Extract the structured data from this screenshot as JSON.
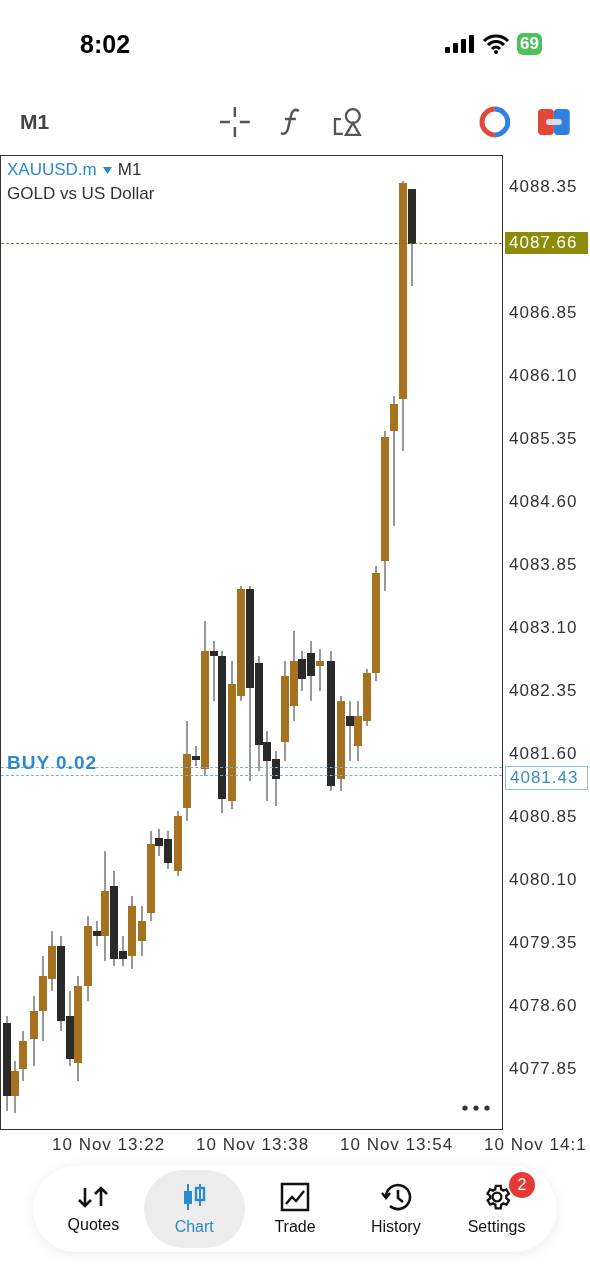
{
  "status_bar": {
    "time": "8:02",
    "battery": "69"
  },
  "toolbar": {
    "timeframe": "M1"
  },
  "chart": {
    "symbol": "XAUUSD.m",
    "timeframe": "M1",
    "description": "GOLD vs US Dollar",
    "price_axis": [
      {
        "text": "4088.35",
        "kind": "tick"
      },
      {
        "text": "4087.66",
        "kind": "current"
      },
      {
        "text": "4086.85",
        "kind": "tick"
      },
      {
        "text": "4086.10",
        "kind": "tick"
      },
      {
        "text": "4085.35",
        "kind": "tick"
      },
      {
        "text": "4084.60",
        "kind": "tick"
      },
      {
        "text": "4083.85",
        "kind": "tick"
      },
      {
        "text": "4083.10",
        "kind": "tick"
      },
      {
        "text": "4082.35",
        "kind": "tick"
      },
      {
        "text": "4081.60",
        "kind": "tick"
      },
      {
        "text": "4081.43",
        "kind": "order"
      },
      {
        "text": "4080.85",
        "kind": "tick"
      },
      {
        "text": "4080.10",
        "kind": "tick"
      },
      {
        "text": "4079.35",
        "kind": "tick"
      },
      {
        "text": "4078.60",
        "kind": "tick"
      },
      {
        "text": "4077.85",
        "kind": "tick"
      }
    ],
    "order_label": "BUY 0.02",
    "time_labels": [
      "10 Nov 13:22",
      "10 Nov 13:38",
      "10 Nov 13:54",
      "10 Nov 14:1"
    ]
  },
  "nav": [
    {
      "label": "Quotes",
      "selected": false
    },
    {
      "label": "Chart",
      "selected": true
    },
    {
      "label": "Trade",
      "selected": false
    },
    {
      "label": "History",
      "selected": false
    },
    {
      "label": "Settings",
      "selected": false,
      "badge": "2"
    }
  ]
}
